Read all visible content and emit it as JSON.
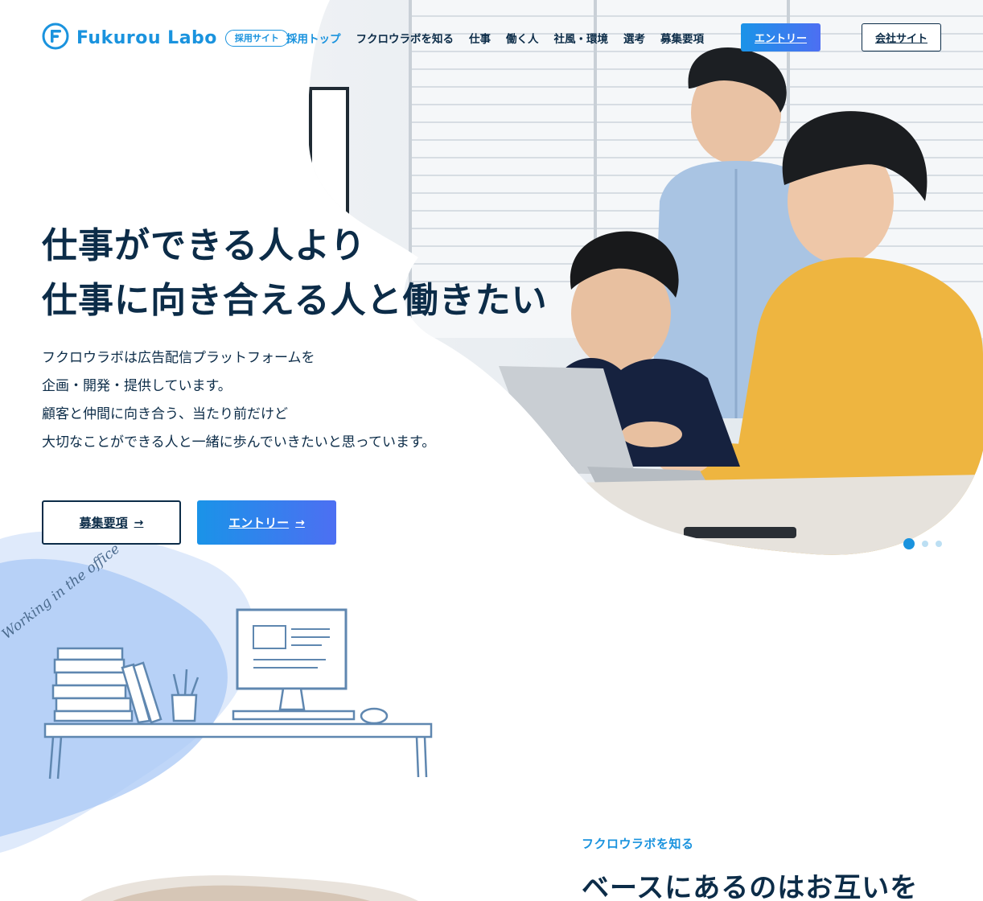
{
  "header": {
    "logo_text": "Fukurou Labo",
    "logo_badge": "採用サイト",
    "nav": [
      "採用トップ",
      "フクロウラボを知る",
      "仕事",
      "働く人",
      "社風・環境",
      "選考",
      "募集要項"
    ],
    "entry_button": "エントリー",
    "company_button": "会社サイト"
  },
  "hero": {
    "headline": [
      "仕事ができる人より",
      "仕事に向き合える人と働きたい"
    ],
    "lead": [
      "フクロウラボは広告配信プラットフォームを",
      "企画・開発・提供しています。",
      "顧客と仲間に向き合う、当たり前だけど",
      "大切なことができる人と一緒に歩んでいきたいと思っています。"
    ],
    "btn_recruit": "募集要項",
    "btn_entry": "エントリー",
    "arrow": "→",
    "slides_total": 3,
    "slide_active": 1
  },
  "illustration": {
    "handwriting": "Working in the office"
  },
  "section": {
    "label": "フクロウラボを知る",
    "title": "ベースにあるのはお互いを"
  },
  "colors": {
    "primary": "#1a93de",
    "navy": "#0c2c48",
    "gradient_start": "#1a93e8",
    "gradient_end": "#4d6ff2",
    "blob": "#a9c8f5"
  },
  "icons": {
    "logo": "owl-f-logo-icon",
    "arrow": "arrow-right-icon"
  }
}
